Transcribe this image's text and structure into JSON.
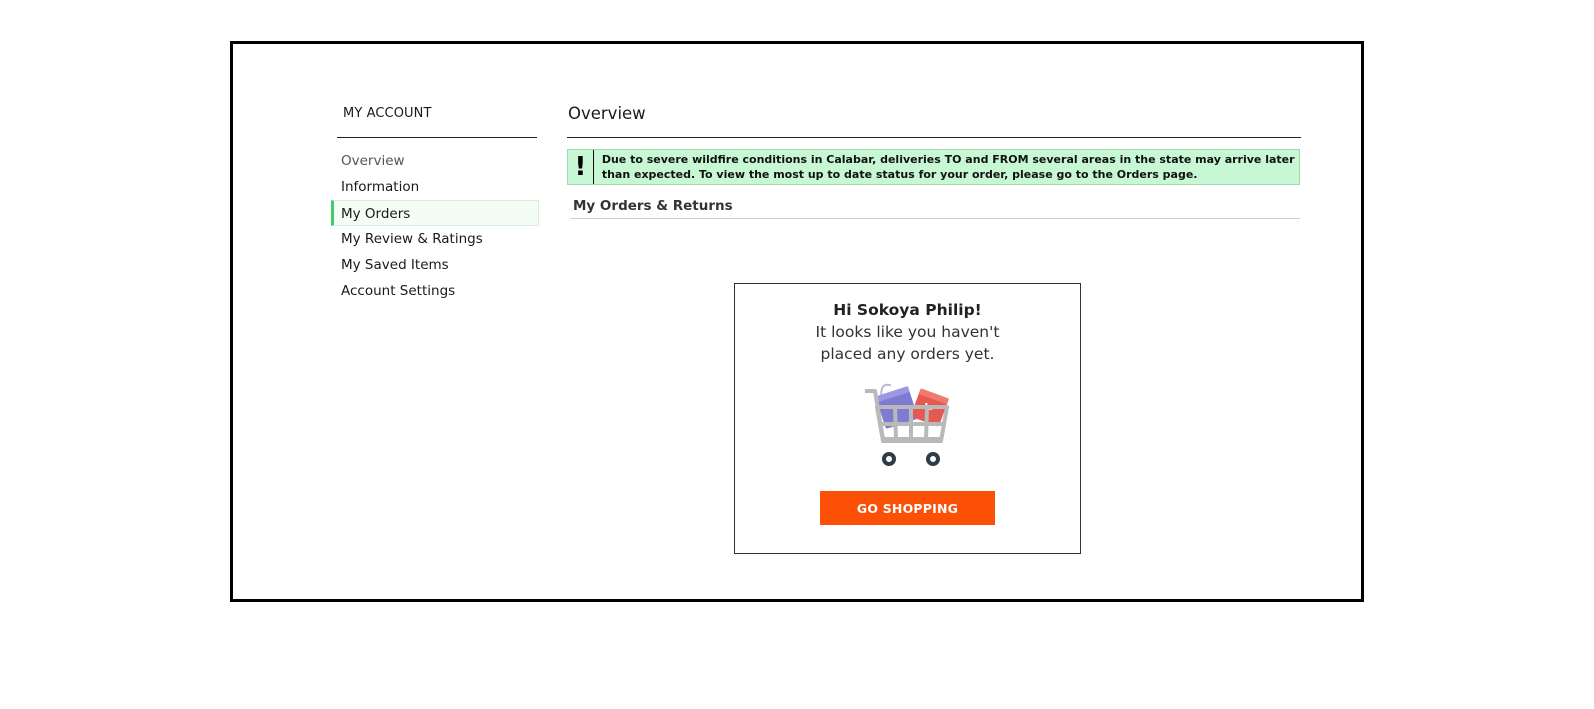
{
  "sidebar": {
    "title": "MY ACCOUNT",
    "items": [
      {
        "label": "Overview"
      },
      {
        "label": "Information"
      },
      {
        "label": "My Orders"
      },
      {
        "label": "My Review & Ratings"
      },
      {
        "label": "My Saved Items"
      },
      {
        "label": "Account Settings"
      }
    ],
    "active_item": "My Orders",
    "active_accent": "#3fcf6a"
  },
  "main": {
    "title": "Overview",
    "alert": {
      "icon": "!",
      "text": "Due to severe wildfire conditions in Calabar, deliveries TO and FROM several areas in the state may arrive later than expected. To view the most up to date status for your order, please go to the Orders page.",
      "background": "#c8f7d4"
    },
    "section_title": "My Orders & Returns",
    "empty_state": {
      "greeting": "Hi Sokoya Philip!",
      "message": "It looks like you haven't placed any orders yet.",
      "illustration": "shopping-cart-with-bags-icon",
      "button_label": "GO SHOPPING",
      "button_color": "#fc5007"
    }
  }
}
